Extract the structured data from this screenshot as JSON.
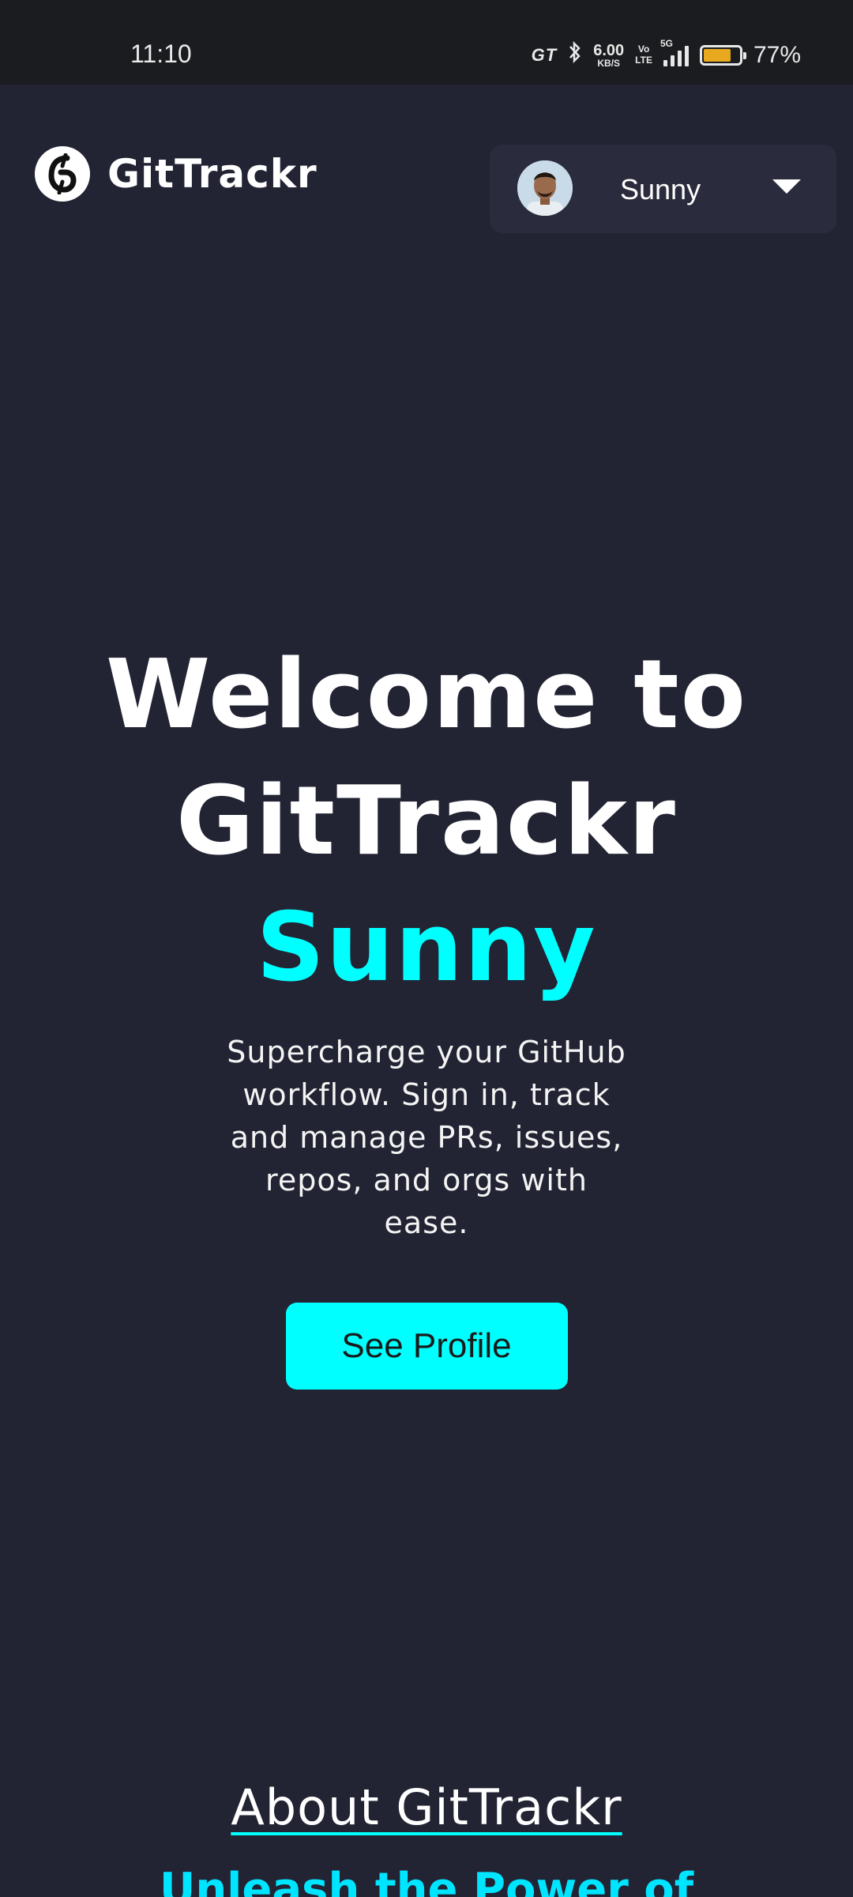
{
  "status_bar": {
    "time": "11:10",
    "carrier_tag": "GT",
    "speed_value": "6.00",
    "speed_unit": "KB/S",
    "volte_top": "Vo",
    "volte_bottom": "LTE",
    "network": "5G",
    "battery_percent": "77%",
    "battery_level": 0.77,
    "battery_color": "#e8a921"
  },
  "header": {
    "brand_name": "GitTrackr",
    "user_menu": {
      "user_name": "Sunny"
    }
  },
  "hero": {
    "line1": "Welcome to",
    "line2": "GitTrackr",
    "user_name": "Sunny",
    "subtitle": "Supercharge your GitHub workflow. Sign in, track and manage PRs, issues, repos, and orgs with ease.",
    "cta_label": "See Profile",
    "accent_color": "#00ffff"
  },
  "about": {
    "title": "About GitTrackr",
    "subtitle": "Unleash the Power of"
  },
  "icons": {
    "brand": "gittrackr-logo-icon",
    "menu": "chevron-down-icon",
    "bluetooth": "bluetooth-icon",
    "signal": "signal-icon",
    "battery": "battery-icon"
  }
}
